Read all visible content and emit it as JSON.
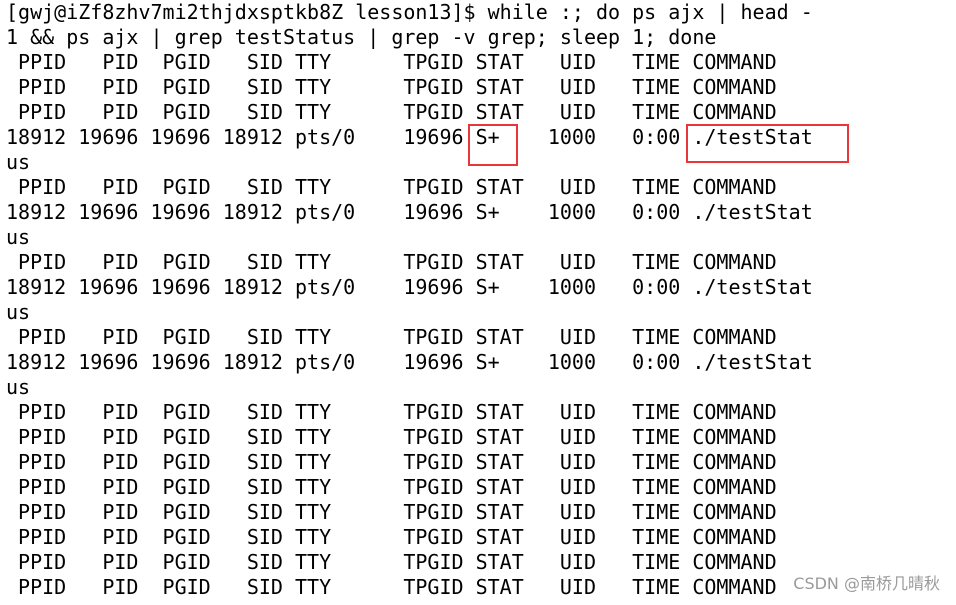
{
  "terminal": {
    "lines": [
      "[gwj@iZf8zhv7mi2thjdxsptkb8Z lesson13]$ while :; do ps ajx | head -",
      "1 && ps ajx | grep testStatus | grep -v grep; sleep 1; done",
      " PPID   PID  PGID   SID TTY      TPGID STAT   UID   TIME COMMAND",
      " PPID   PID  PGID   SID TTY      TPGID STAT   UID   TIME COMMAND",
      " PPID   PID  PGID   SID TTY      TPGID STAT   UID   TIME COMMAND",
      "18912 19696 19696 18912 pts/0    19696 S+    1000   0:00 ./testStat",
      "us",
      " PPID   PID  PGID   SID TTY      TPGID STAT   UID   TIME COMMAND",
      "18912 19696 19696 18912 pts/0    19696 S+    1000   0:00 ./testStat",
      "us",
      " PPID   PID  PGID   SID TTY      TPGID STAT   UID   TIME COMMAND",
      "18912 19696 19696 18912 pts/0    19696 S+    1000   0:00 ./testStat",
      "us",
      " PPID   PID  PGID   SID TTY      TPGID STAT   UID   TIME COMMAND",
      "18912 19696 19696 18912 pts/0    19696 S+    1000   0:00 ./testStat",
      "us",
      " PPID   PID  PGID   SID TTY      TPGID STAT   UID   TIME COMMAND",
      " PPID   PID  PGID   SID TTY      TPGID STAT   UID   TIME COMMAND",
      " PPID   PID  PGID   SID TTY      TPGID STAT   UID   TIME COMMAND",
      " PPID   PID  PGID   SID TTY      TPGID STAT   UID   TIME COMMAND",
      " PPID   PID  PGID   SID TTY      TPGID STAT   UID   TIME COMMAND",
      " PPID   PID  PGID   SID TTY      TPGID STAT   UID   TIME COMMAND",
      " PPID   PID  PGID   SID TTY      TPGID STAT   UID   TIME COMMAND",
      " PPID   PID  PGID   SID TTY      TPGID STAT   UID   TIME COMMAND"
    ]
  },
  "highlight_color": "#e8373a",
  "watermark": "CSDN @南桥几晴秋"
}
